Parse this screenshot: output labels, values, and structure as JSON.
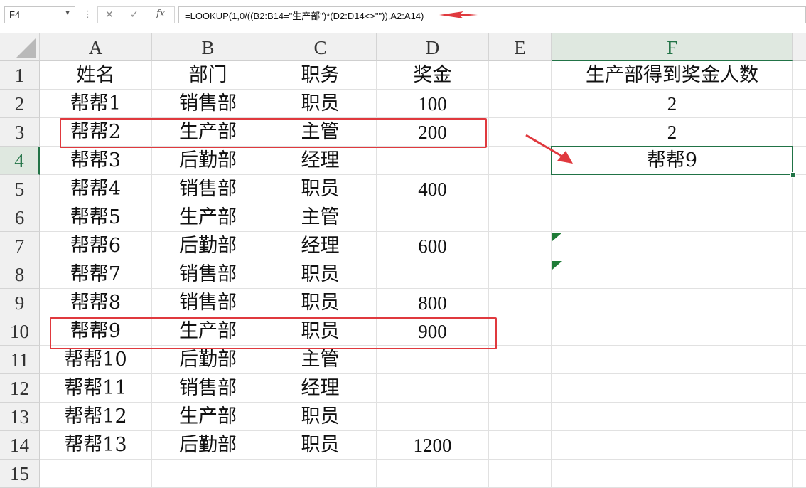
{
  "name_box": "F4",
  "formula": "=LOOKUP(1,0/((B2:B14=\"生产部\")*(D2:D14<>\"\")),A2:A14)",
  "columns": [
    "A",
    "B",
    "C",
    "D",
    "E",
    "F"
  ],
  "rows": [
    "1",
    "2",
    "3",
    "4",
    "5",
    "6",
    "7",
    "8",
    "9",
    "10",
    "11",
    "12",
    "13",
    "14",
    "15"
  ],
  "cells": [
    [
      "姓名",
      "部门",
      "职务",
      "奖金",
      "",
      "生产部得到奖金人数"
    ],
    [
      "帮帮1",
      "销售部",
      "职员",
      "100",
      "",
      "2"
    ],
    [
      "帮帮2",
      "生产部",
      "主管",
      "200",
      "",
      "2"
    ],
    [
      "帮帮3",
      "后勤部",
      "经理",
      "",
      "",
      "帮帮9"
    ],
    [
      "帮帮4",
      "销售部",
      "职员",
      "400",
      "",
      ""
    ],
    [
      "帮帮5",
      "生产部",
      "主管",
      "",
      "",
      ""
    ],
    [
      "帮帮6",
      "后勤部",
      "经理",
      "600",
      "",
      ""
    ],
    [
      "帮帮7",
      "销售部",
      "职员",
      "",
      "",
      ""
    ],
    [
      "帮帮8",
      "销售部",
      "职员",
      "800",
      "",
      ""
    ],
    [
      "帮帮9",
      "生产部",
      "职员",
      "900",
      "",
      ""
    ],
    [
      "帮帮10",
      "后勤部",
      "主管",
      "",
      "",
      ""
    ],
    [
      "帮帮11",
      "销售部",
      "经理",
      "",
      "",
      ""
    ],
    [
      "帮帮12",
      "生产部",
      "职员",
      "",
      "",
      ""
    ],
    [
      "帮帮13",
      "后勤部",
      "职员",
      "1200",
      "",
      ""
    ],
    [
      "",
      "",
      "",
      "",
      "",
      ""
    ]
  ],
  "icons": {
    "cancel": "cancel-icon",
    "enter": "enter-icon",
    "function": "fx-icon"
  },
  "fx_label": "fx",
  "colors": {
    "accent": "#217346",
    "highlight": "#e0393e"
  }
}
